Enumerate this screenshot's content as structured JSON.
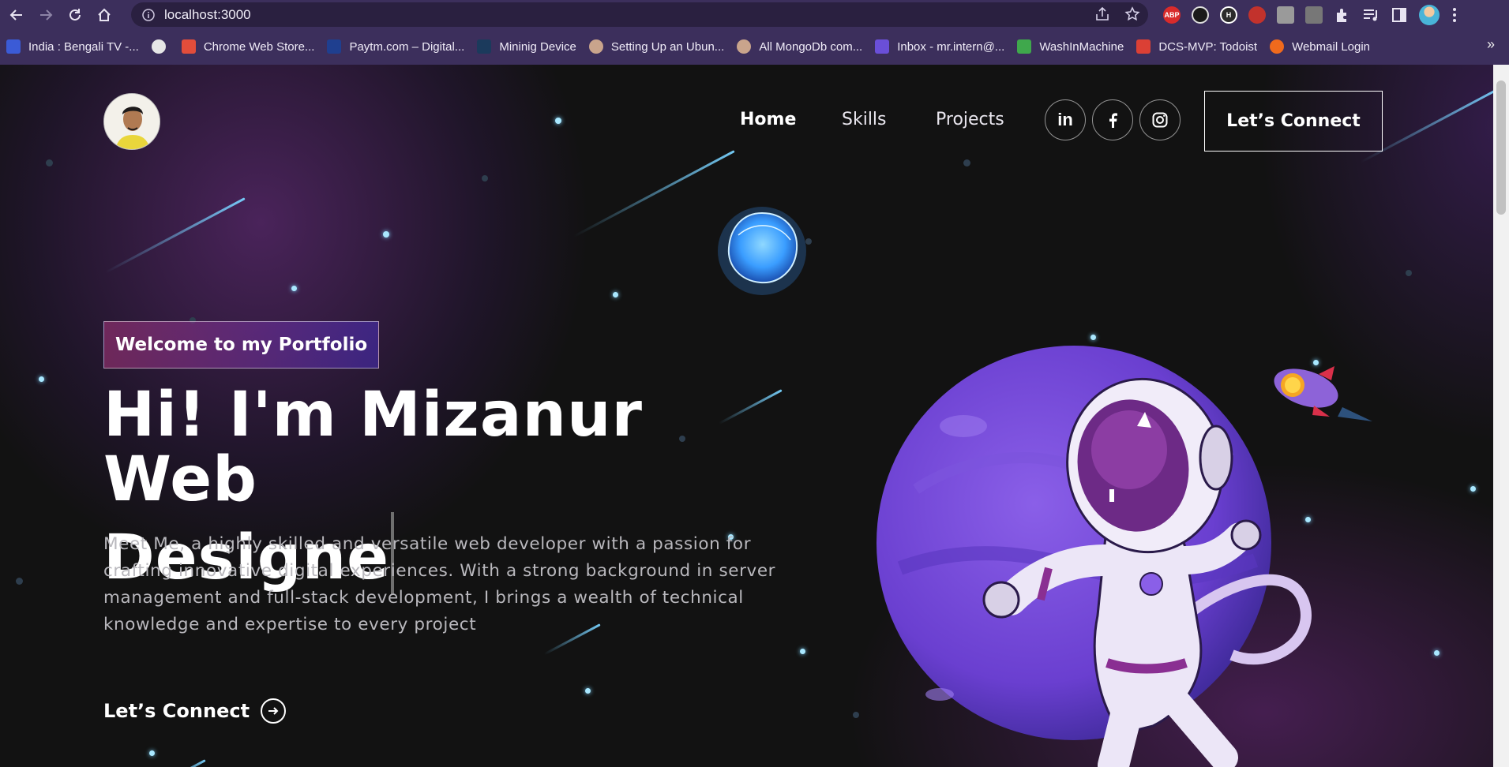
{
  "browser": {
    "url": "localhost:3000",
    "bookmarks": [
      {
        "label": "India : Bengali TV -...",
        "color": "#3b5bd6"
      },
      {
        "label": "",
        "color": "#e6e6e6"
      },
      {
        "label": "Chrome Web Store...",
        "color": "#e24d3b"
      },
      {
        "label": "Paytm.com – Digital...",
        "color": "#1f3f8f"
      },
      {
        "label": "Mininig Device",
        "color": "#1b3a5c"
      },
      {
        "label": "Setting Up an Ubun...",
        "color": "#c9a48c"
      },
      {
        "label": "All MongoDb com...",
        "color": "#c9a48c"
      },
      {
        "label": "Inbox - mr.intern@...",
        "color": "#6a4fd8"
      },
      {
        "label": "WashInMachine",
        "color": "#3fa84c"
      },
      {
        "label": "DCS-MVP: Todoist",
        "color": "#db4035"
      },
      {
        "label": "Webmail Login",
        "color": "#f06a1d"
      }
    ],
    "more_symbol": "»",
    "extensions": [
      {
        "icon": "adblock-icon",
        "text": "ABP",
        "color": "#d92b2b"
      },
      {
        "icon": "mask-extension-icon",
        "text": "",
        "color": "#1a1a1a"
      },
      {
        "icon": "h-extension-icon",
        "text": "H",
        "color": "#2b2b2b"
      },
      {
        "icon": "cat-extension-icon",
        "text": "",
        "color": "#c2322c"
      },
      {
        "icon": "gray-extension-icon",
        "text": "",
        "color": "#9a9a9a"
      },
      {
        "icon": "gray-square-extension-icon",
        "text": "",
        "color": "#777777"
      }
    ]
  },
  "nav": {
    "links": [
      "Home",
      "Skills",
      "Projects"
    ],
    "active": "Home",
    "social": [
      "linkedin-icon",
      "facebook-icon",
      "instagram-icon"
    ],
    "linkedin_text": "in",
    "cta": "Let’s Connect"
  },
  "hero": {
    "tagline": "Welcome to my Portfolio",
    "headline_line1": "Hi! I'm Mizanur Web",
    "headline_line2": "Designe",
    "description": "Meet Me, a highly skilled and versatile web developer with a passion for crafting innovative digital experiences. With a strong background in server management and full-stack development, I brings a wealth of technical knowledge and expertise to every project",
    "cta": "Let’s Connect"
  },
  "colors": {
    "chrome": "#3c2f5c",
    "page_bg": "#121212",
    "accent_purple": "#6a3fd0",
    "star": "#a9e8ff"
  }
}
